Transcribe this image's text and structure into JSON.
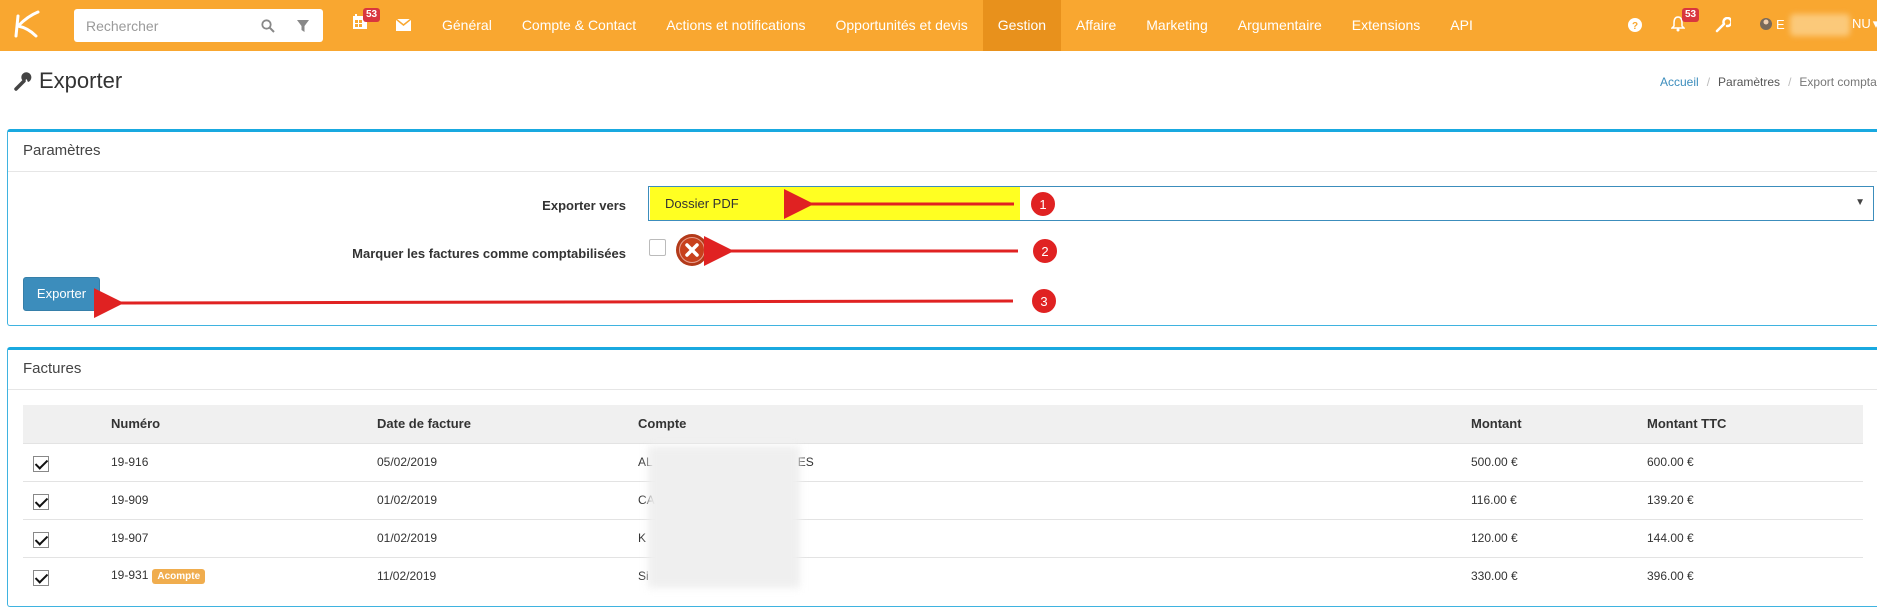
{
  "topbar": {
    "search": {
      "placeholder": "Rechercher"
    },
    "calendar_badge": "53",
    "notif_badge": "53",
    "menu": [
      {
        "label": "Général",
        "active": false
      },
      {
        "label": "Compte & Contact",
        "active": false
      },
      {
        "label": "Actions et notifications",
        "active": false
      },
      {
        "label": "Opportunités et devis",
        "active": false
      },
      {
        "label": "Gestion",
        "active": true
      },
      {
        "label": "Affaire",
        "active": false
      },
      {
        "label": "Marketing",
        "active": false
      },
      {
        "label": "Argumentaire",
        "active": false
      },
      {
        "label": "Extensions",
        "active": false
      },
      {
        "label": "API",
        "active": false
      }
    ],
    "user_initial": "E",
    "user_suffix": "NU"
  },
  "page": {
    "title": "Exporter"
  },
  "breadcrumb": {
    "home": "Accueil",
    "params": "Paramètres",
    "current": "Export comptable"
  },
  "parametres": {
    "title": "Paramètres",
    "export_label": "Exporter vers",
    "export_value": "Dossier PDF",
    "mark_label": "Marquer les factures comme comptabilisées",
    "export_button": "Exporter"
  },
  "annotations": [
    "1",
    "2",
    "3"
  ],
  "factures": {
    "title": "Factures",
    "columns": [
      "Numéro",
      "Date de facture",
      "Compte",
      "Montant",
      "Montant TTC"
    ],
    "rows": [
      {
        "numero": "19-916",
        "date": "05/02/2019",
        "compte_start": "AL",
        "compte_end": "ES",
        "montant": "500.00 €",
        "ttc": "600.00 €",
        "acompte": ""
      },
      {
        "numero": "19-909",
        "date": "01/02/2019",
        "compte_start": "CA",
        "compte_end": "",
        "montant": "116.00 €",
        "ttc": "139.20 €",
        "acompte": ""
      },
      {
        "numero": "19-907",
        "date": "01/02/2019",
        "compte_start": "K",
        "compte_end": "",
        "montant": "120.00 €",
        "ttc": "144.00 €",
        "acompte": ""
      },
      {
        "numero": "19-931",
        "date": "11/02/2019",
        "compte_start": "Si",
        "compte_end": "",
        "montant": "330.00 €",
        "ttc": "396.00 €",
        "acompte": "Acompte"
      }
    ]
  },
  "colors": {
    "nav_bg": "#f9a730",
    "nav_active": "#e8911c",
    "primary": "#3c8dbc",
    "panel_border": "#19a9e0",
    "highlight": "#ffff22",
    "annotation_red": "#e02222"
  }
}
